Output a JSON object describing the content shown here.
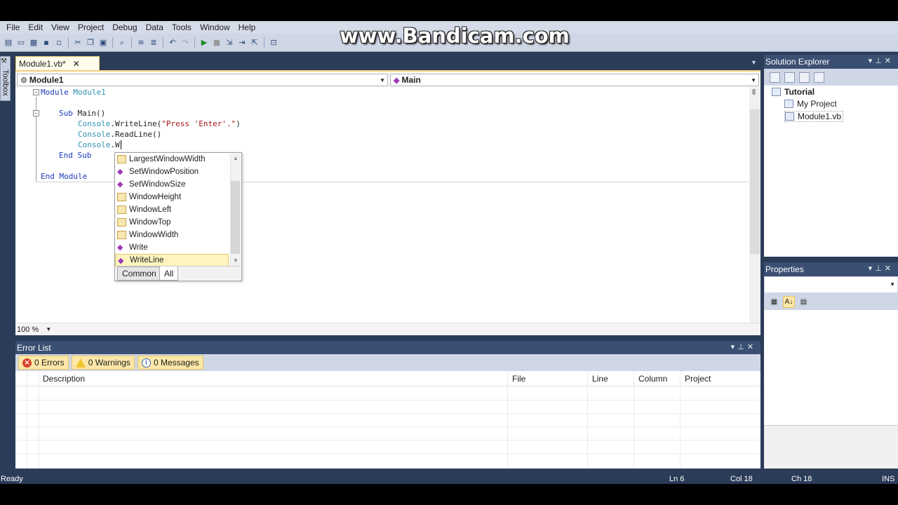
{
  "menu": [
    "File",
    "Edit",
    "View",
    "Project",
    "Debug",
    "Data",
    "Tools",
    "Window",
    "Help"
  ],
  "watermark": "www.Bandicam.com",
  "toolbox_label": "Toolbox",
  "doc_tab": {
    "label": "Module1.vb*",
    "close": "✕"
  },
  "nav": {
    "left": "Module1",
    "right": "Main"
  },
  "code": {
    "l1_kw": "Module",
    "l1_name": " Module1",
    "l2_kw": "Sub",
    "l2_rest": " Main()",
    "l3_obj": "Console",
    "l3_mid": ".WriteLine(",
    "l3_str": "\"Press 'Enter'.\"",
    "l3_end": ")",
    "l4_obj": "Console",
    "l4_rest": ".ReadLine()",
    "l5_obj": "Console",
    "l5_rest": ".W",
    "l6": "End Sub",
    "l7": "End Module"
  },
  "intellisense": {
    "items": [
      {
        "label": "LargestWindowWidth",
        "icon": "property-icon"
      },
      {
        "label": "SetWindowPosition",
        "icon": "method-icon"
      },
      {
        "label": "SetWindowSize",
        "icon": "method-icon"
      },
      {
        "label": "WindowHeight",
        "icon": "property-icon"
      },
      {
        "label": "WindowLeft",
        "icon": "property-icon"
      },
      {
        "label": "WindowTop",
        "icon": "property-icon"
      },
      {
        "label": "WindowWidth",
        "icon": "property-icon"
      },
      {
        "label": "Write",
        "icon": "method-icon"
      },
      {
        "label": "WriteLine",
        "icon": "method-icon",
        "selected": true
      }
    ],
    "tabs": [
      "Common",
      "All"
    ]
  },
  "zoom": "100 %",
  "error_list": {
    "title": "Error List",
    "errors": "0 Errors",
    "warnings": "0 Warnings",
    "messages": "0 Messages",
    "columns": [
      "Description",
      "File",
      "Line",
      "Column",
      "Project"
    ]
  },
  "solution_explorer": {
    "title": "Solution Explorer",
    "root": "Tutorial",
    "items": [
      "My Project",
      "Module1.vb"
    ]
  },
  "properties": {
    "title": "Properties"
  },
  "status": {
    "ready": "Ready",
    "ln": "Ln 6",
    "col": "Col 18",
    "ch": "Ch 18",
    "ins": "INS"
  },
  "colors": {
    "accent": "#3b4f72",
    "frame": "#2b3c59",
    "highlight": "#fdf4bf"
  }
}
